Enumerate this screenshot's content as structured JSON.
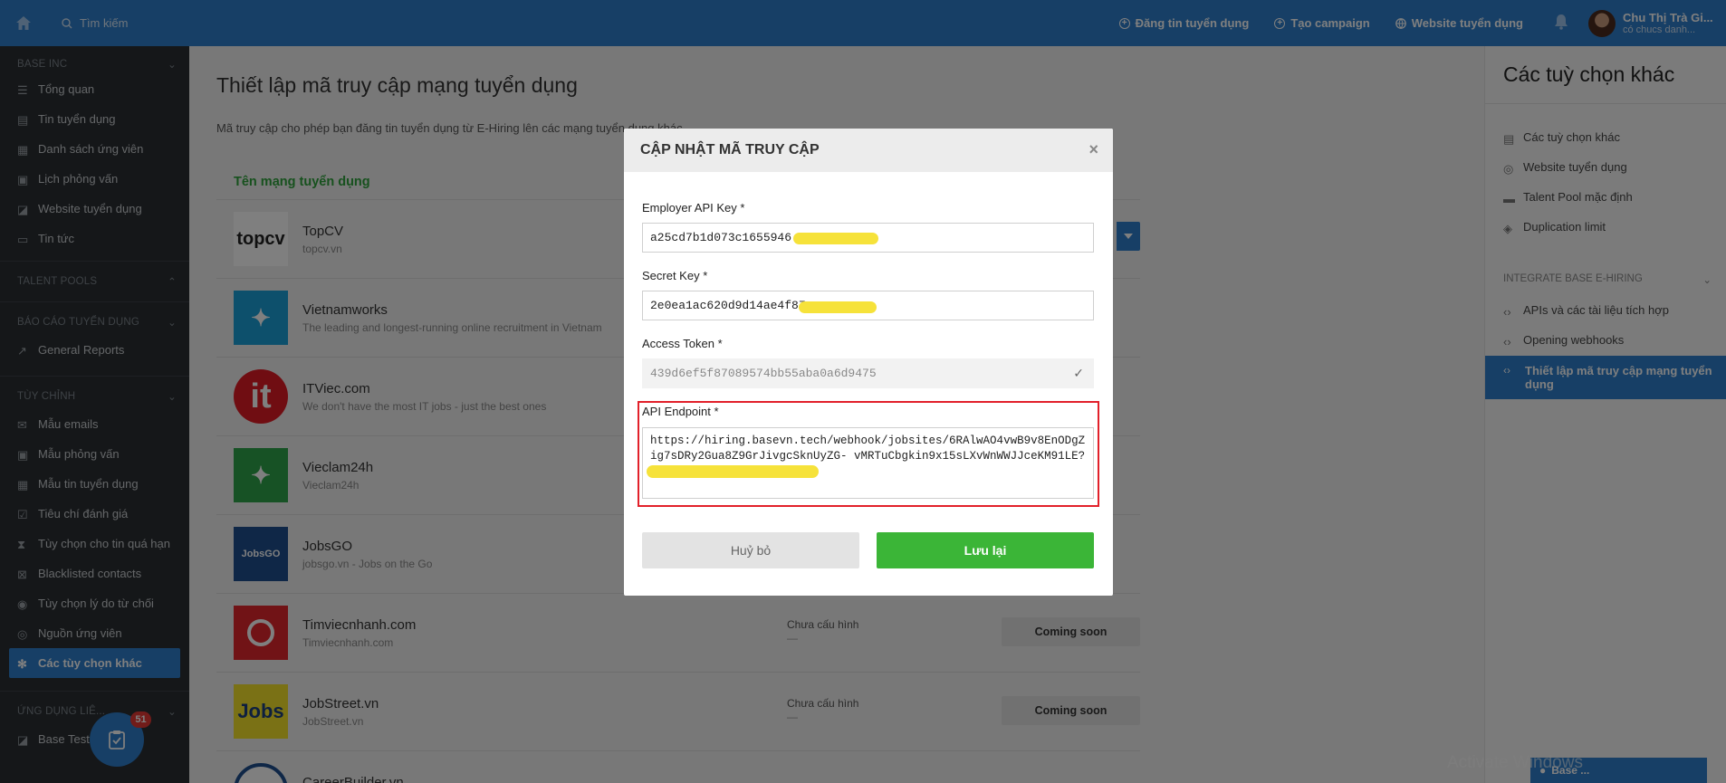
{
  "topbar": {
    "search_placeholder": "Tìm kiếm",
    "links": [
      "Đăng tin tuyển dụng",
      "Tạo campaign",
      "Website tuyển dụng"
    ],
    "user_name": "Chu Thị Trà Gi...",
    "user_sub": "có chucs danh..."
  },
  "sidebar": {
    "company": "BASE INC",
    "main_items": [
      "Tổng quan",
      "Tin tuyển dụng",
      "Danh sách ứng viên",
      "Lịch phỏng vấn",
      "Website tuyển dụng",
      "Tin tức"
    ],
    "talent_pools": "TALENT POOLS",
    "reports_group": "BÁO CÁO TUYỂN DỤNG",
    "reports_items": [
      "General Reports"
    ],
    "custom_group": "TÙY CHỈNH",
    "custom_items": [
      "Mẫu emails",
      "Mẫu phỏng vấn",
      "Mẫu tin tuyển dụng",
      "Tiêu chí đánh giá",
      "Tùy chọn cho tin quá hạn",
      "Blacklisted contacts",
      "Tùy chọn lý do từ chối",
      "Nguồn ứng viên",
      "Các tùy chọn khác"
    ],
    "apps_group": "ỨNG DỤNG LIÊ...",
    "apps_items": [
      "Base Test"
    ]
  },
  "main": {
    "title": "Thiết lập mã truy cập mạng tuyển dụng",
    "desc": "Mã truy cập cho phép bạn đăng tin tuyển dụng từ E-Hiring lên các mạng tuyển dụng khác.",
    "col_header": "Tên mạng tuyển dụng",
    "rows": [
      {
        "name": "TopCV",
        "sub": "topcv.vn",
        "status": "",
        "dash": "",
        "btn": "",
        "logo_text": "topcv",
        "logo_color": "#ffffff",
        "logo_fg": "#222222"
      },
      {
        "name": "Vietnamworks",
        "sub": "The leading and longest-running online recruitment in Vietnam",
        "status": "",
        "dash": "",
        "btn": "",
        "logo_text": "",
        "logo_color": "#1aa1d9",
        "logo_fg": "#ffffff"
      },
      {
        "name": "ITViec.com",
        "sub": "We don't have the most IT jobs - just the best ones",
        "status": "",
        "dash": "",
        "btn": "",
        "logo_text": "it",
        "logo_color": "#e01b24",
        "logo_fg": "#ffffff"
      },
      {
        "name": "Vieclam24h",
        "sub": "Vieclam24h",
        "status": "",
        "dash": "",
        "btn": "",
        "logo_text": "",
        "logo_color": "#2ea54a",
        "logo_fg": "#ffffff"
      },
      {
        "name": "JobsGO",
        "sub": "jobsgo.vn - Jobs on the Go",
        "status": "",
        "dash": "",
        "btn": "",
        "logo_text": "JobsGO",
        "logo_color": "#1e4f8f",
        "logo_fg": "#ffffff"
      },
      {
        "name": "Timviecnhanh.com",
        "sub": "Timviecnhanh.com",
        "status": "Chưa cấu hình",
        "dash": "—",
        "btn": "Coming soon",
        "logo_text": "",
        "logo_color": "#e3262c",
        "logo_fg": "#ffffff"
      },
      {
        "name": "JobStreet.vn",
        "sub": "JobStreet.vn",
        "status": "Chưa cấu hình",
        "dash": "—",
        "btn": "Coming soon",
        "logo_text": "Jobs",
        "logo_color": "#f5e22b",
        "logo_fg": "#1d3f7e"
      },
      {
        "name": "CareerBuilder.vn",
        "sub": "",
        "status": "",
        "dash": "",
        "btn": "",
        "logo_text": "",
        "logo_color": "#ffffff",
        "logo_fg": "#1e4f8f"
      }
    ]
  },
  "right_panel": {
    "title": "Các tuỳ chọn khác",
    "items": [
      "Các tuỳ chọn khác",
      "Website tuyển dụng",
      "Talent Pool mặc định",
      "Duplication limit"
    ],
    "group": "INTEGRATE BASE E-HIRING",
    "group_items": [
      "APIs và các tài liệu tích hợp",
      "Opening webhooks"
    ],
    "active_item": "Thiết lập mã truy cập mạng tuyển dụng"
  },
  "modal": {
    "title": "CẬP NHẬT MÃ TRUY CẬP",
    "api_key_label": "Employer API Key *",
    "api_key_value": "a25cd7b1d073c1655946",
    "secret_label": "Secret Key *",
    "secret_value": "2e0ea1ac620d9d14ae4f87",
    "token_label": "Access Token *",
    "token_value": "439d6ef5f87089574bb55aba0a6d9475",
    "endpoint_label": "API Endpoint *",
    "endpoint_value": "https://hiring.basevn.tech/webhook/jobsites/6RAlwAO4vwB9v8EnODgZig7sDRy2Gua8Z9GrJivgcSknUyZG-                        vMRTuCbgkin9x15sLXvWnWWJJceKM91LE?code=topcv",
    "cancel_label": "Huỷ bỏ",
    "save_label": "Lưu lại"
  },
  "floating": {
    "badge_count": "51",
    "chat_label": "Base ..."
  },
  "windows": {
    "activate_text": "Activate Windows"
  },
  "colors": {
    "brand_blue": "#2e7fcd",
    "sidebar_bg": "#2b2f33",
    "save_green": "#3bb537",
    "highlight_red": "#e2202a",
    "header_green": "#2fa33c"
  }
}
